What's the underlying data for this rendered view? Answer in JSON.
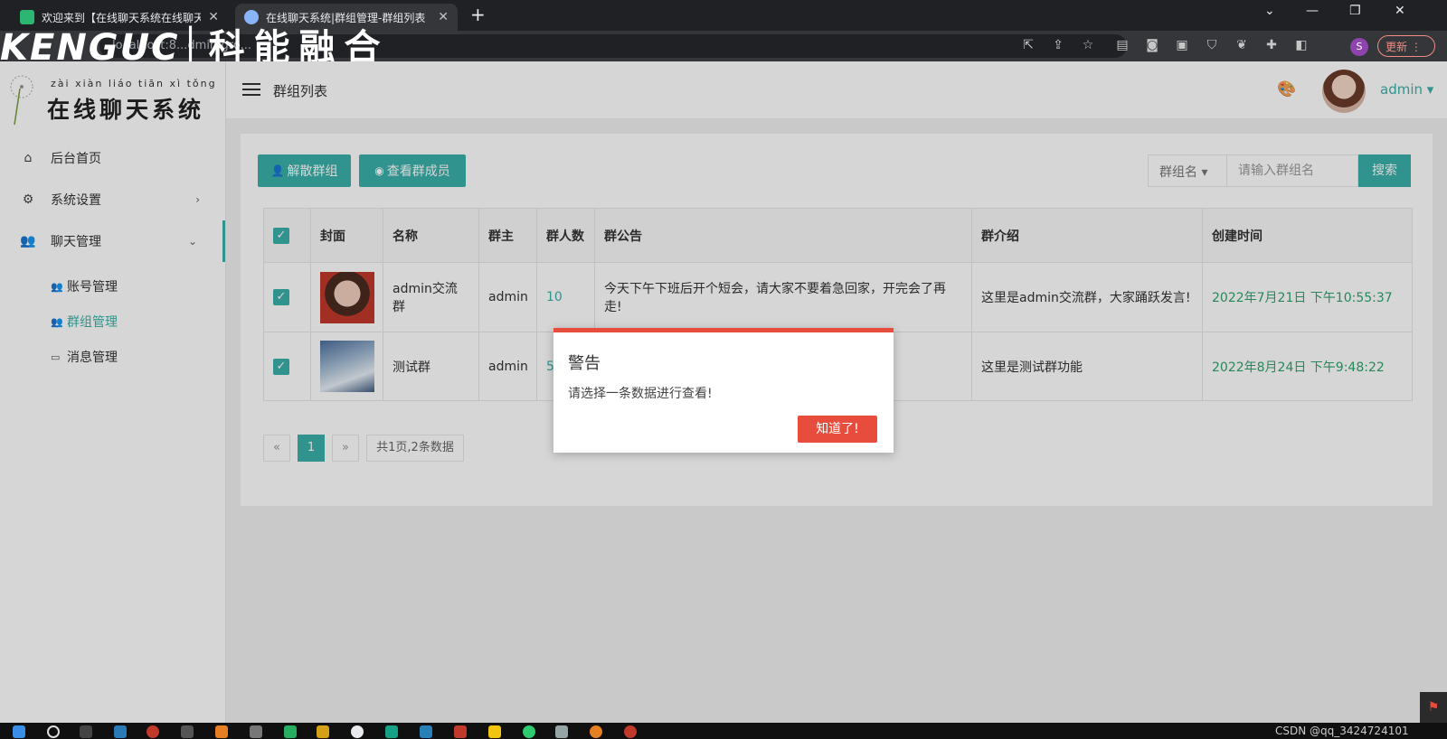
{
  "browser": {
    "tabs": [
      {
        "title": "欢迎来到【在线聊天系统在线聊天",
        "active": false
      },
      {
        "title": "在线聊天系统|群组管理-群组列表",
        "active": true
      }
    ],
    "new_tab": "+",
    "url": "localhost:8...dmin/gro...",
    "update_label": "更新",
    "profile_initial": "S"
  },
  "watermark": {
    "en": "KENGUC",
    "cn": "科能融合"
  },
  "logo": {
    "pinyin": "zài xiàn liáo tiān xì tǒng",
    "text": "在线聊天系统"
  },
  "sidebar": {
    "items": [
      {
        "label": "后台首页",
        "icon": "home-icon"
      },
      {
        "label": "系统设置",
        "icon": "gear-icon",
        "arrow": "›"
      },
      {
        "label": "聊天管理",
        "icon": "users-icon",
        "arrow": "⌄"
      }
    ],
    "subitems": [
      {
        "label": "账号管理",
        "icon": "account-icon"
      },
      {
        "label": "群组管理",
        "icon": "group-icon",
        "active": true
      },
      {
        "label": "消息管理",
        "icon": "message-icon"
      }
    ]
  },
  "header": {
    "title": "群组列表",
    "user": "admin",
    "user_caret": "▾"
  },
  "toolbar": {
    "dissolve_label": "解散群组",
    "view_members_label": "查看群成员"
  },
  "search": {
    "field_label": "群组名",
    "placeholder": "请输入群组名",
    "button": "搜索"
  },
  "table": {
    "columns": [
      "封面",
      "名称",
      "群主",
      "群人数",
      "群公告",
      "群介绍",
      "创建时间"
    ],
    "rows": [
      {
        "name": "admin交流群",
        "owner": "admin",
        "count": "10",
        "notice": "今天下午下班后开个短会，请大家不要着急回家，开完会了再走!",
        "intro": "这里是admin交流群，大家踊跃发言!",
        "created": "2022年7月21日 下午10:55:37",
        "checked": true
      },
      {
        "name": "测试群",
        "owner": "admin",
        "count": "5",
        "notice": "",
        "intro": "这里是测试群功能",
        "created": "2022年8月24日 下午9:48:22",
        "checked": true
      }
    ]
  },
  "pagination": {
    "prev": "«",
    "current": "1",
    "next": "»",
    "info": "共1页,2条数据"
  },
  "dialog": {
    "title": "警告",
    "message": "请选择一条数据进行查看!",
    "ok": "知道了!"
  },
  "taskbar": {
    "tray_text": "CSDN @qq_3424724101"
  },
  "colors": {
    "accent": "#3ab0a8",
    "danger": "#e74c3c",
    "time": "#2fa36b"
  }
}
